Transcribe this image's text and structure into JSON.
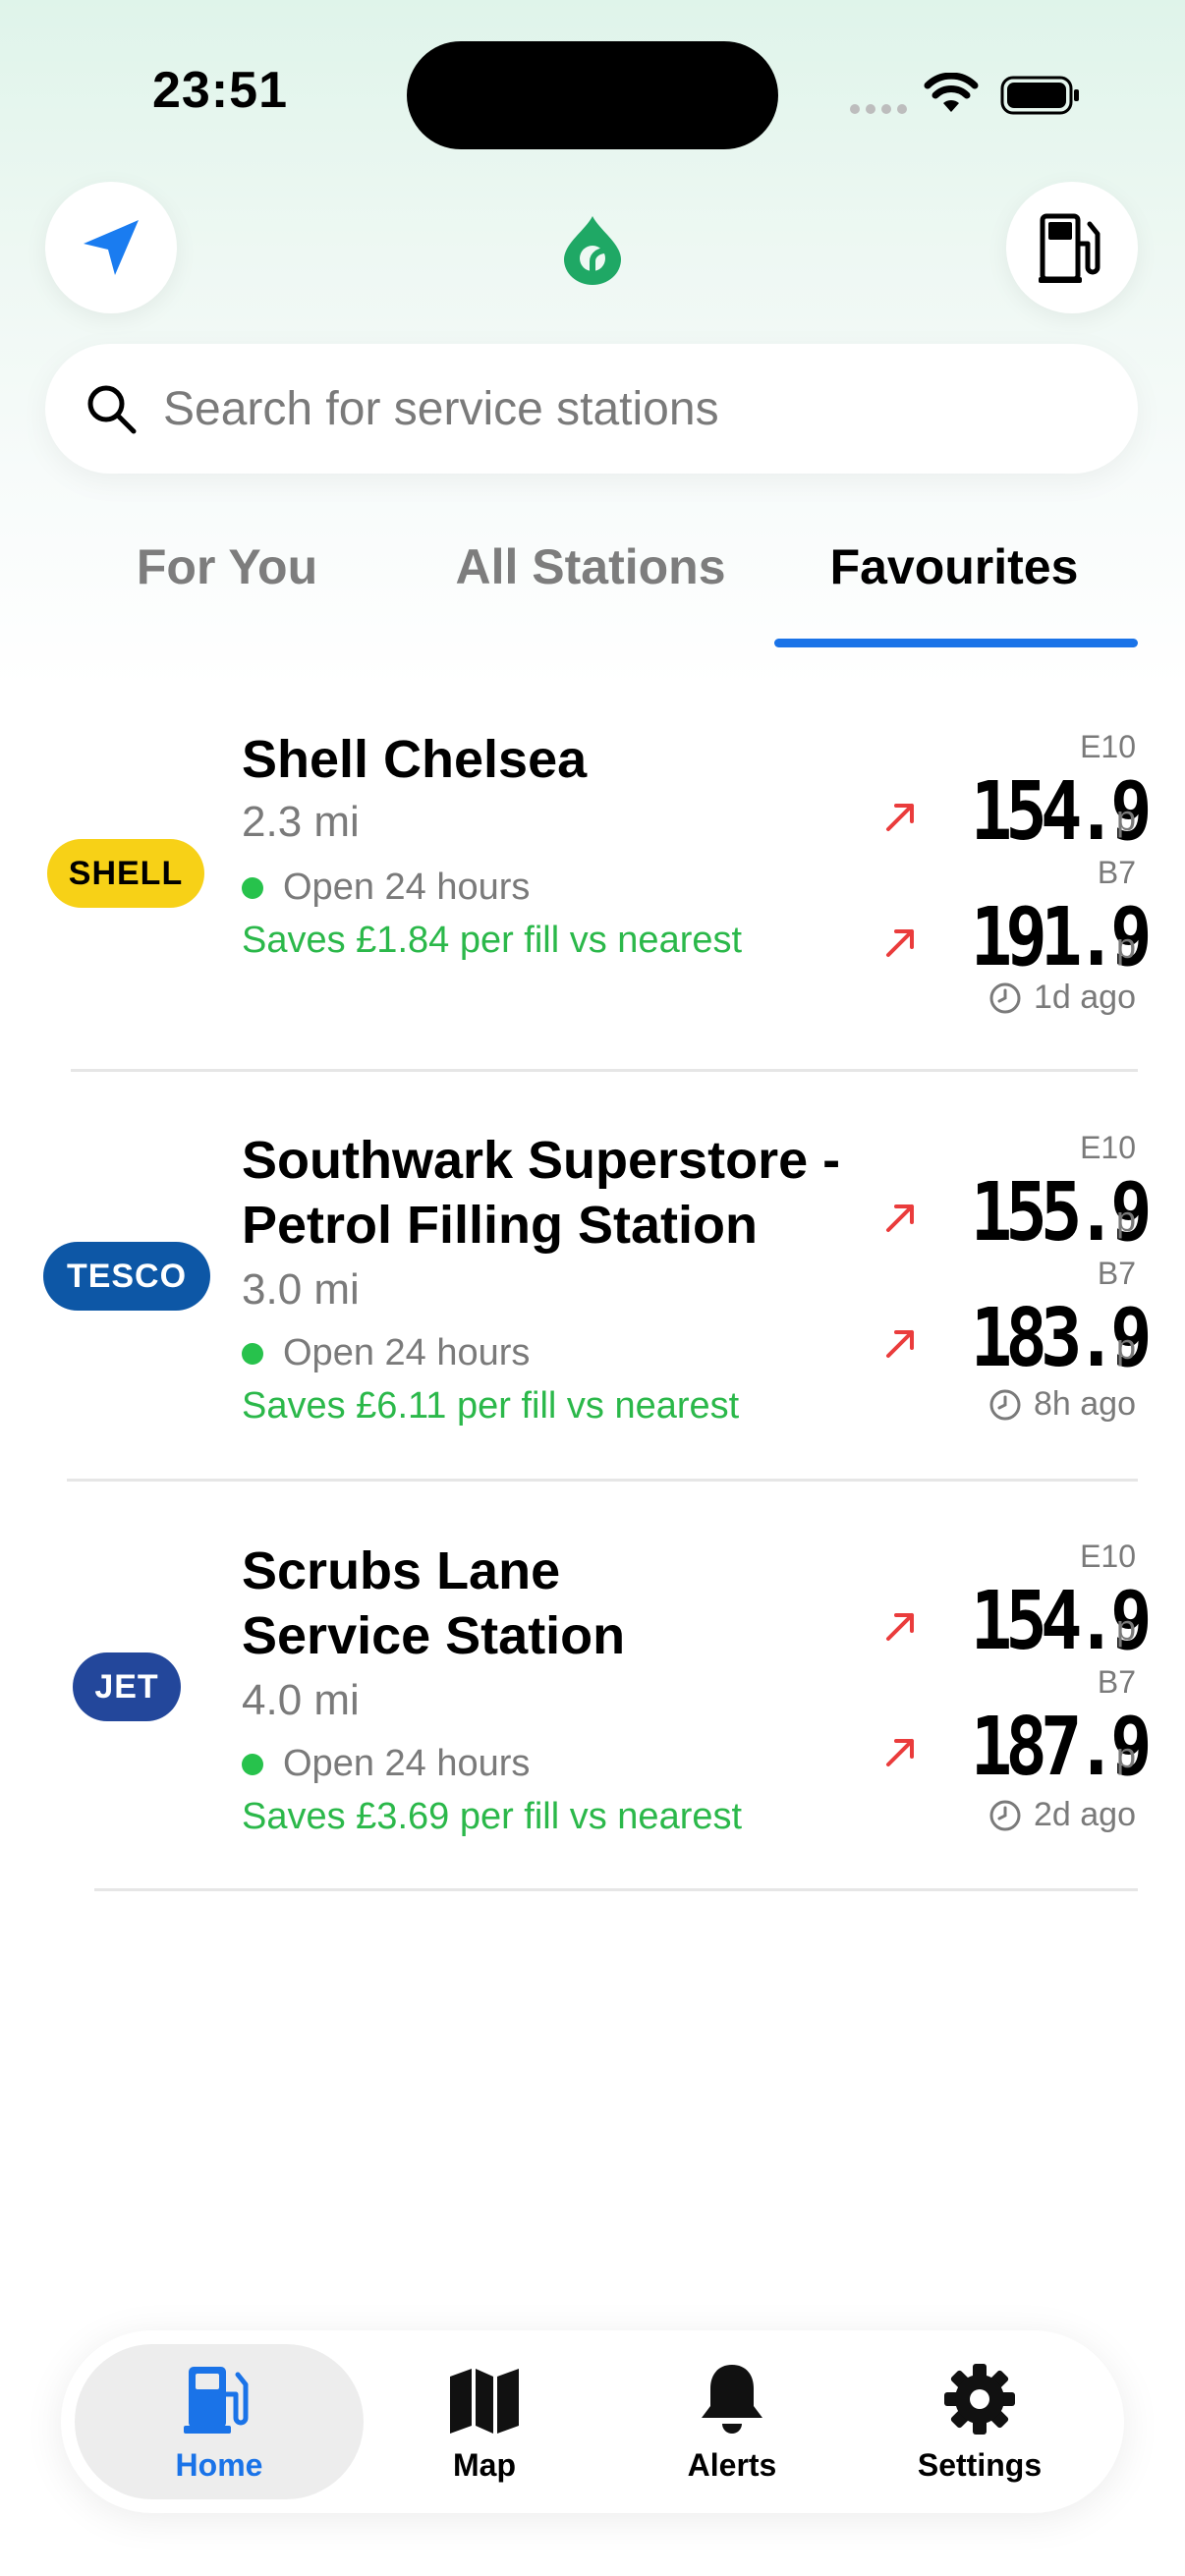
{
  "status_bar": {
    "time": "23:51"
  },
  "search": {
    "placeholder": "Search for service stations"
  },
  "tabs": [
    {
      "label": "For You",
      "active": false
    },
    {
      "label": "All Stations",
      "active": false
    },
    {
      "label": "Favourites",
      "active": true
    }
  ],
  "stations": [
    {
      "brand": "SHELL",
      "name_lines": [
        "Shell Chelsea"
      ],
      "distance": "2.3 mi",
      "status": "Open 24 hours",
      "saves": "Saves £1.84 per fill vs nearest",
      "fuels": [
        {
          "type": "E10",
          "price": "154.9",
          "unit": "p",
          "trend": "up"
        },
        {
          "type": "B7",
          "price": "191.9",
          "unit": "p",
          "trend": "up"
        }
      ],
      "updated": "1d ago"
    },
    {
      "brand": "TESCO",
      "name_lines": [
        "Southwark Superstore -",
        "Petrol Filling Station"
      ],
      "distance": "3.0 mi",
      "status": "Open 24 hours",
      "saves": "Saves £6.11 per fill vs nearest",
      "fuels": [
        {
          "type": "E10",
          "price": "155.9",
          "unit": "p",
          "trend": "up"
        },
        {
          "type": "B7",
          "price": "183.9",
          "unit": "p",
          "trend": "up"
        }
      ],
      "updated": "8h ago"
    },
    {
      "brand": "JET",
      "name_lines": [
        "Scrubs Lane",
        "Service Station"
      ],
      "distance": "4.0 mi",
      "status": "Open 24 hours",
      "saves": "Saves £3.69 per fill vs nearest",
      "fuels": [
        {
          "type": "E10",
          "price": "154.9",
          "unit": "p",
          "trend": "up"
        },
        {
          "type": "B7",
          "price": "187.9",
          "unit": "p",
          "trend": "up"
        }
      ],
      "updated": "2d ago"
    }
  ],
  "tab_bar": [
    {
      "label": "Home",
      "icon": "fuel-pump-icon",
      "active": true
    },
    {
      "label": "Map",
      "icon": "map-icon",
      "active": false
    },
    {
      "label": "Alerts",
      "icon": "bell-icon",
      "active": false
    },
    {
      "label": "Settings",
      "icon": "gear-icon",
      "active": false
    }
  ],
  "colors": {
    "accent_blue": "#1a73e8",
    "brand_green": "#1fa865",
    "saves_green": "#2bb84a",
    "trend_red": "#ea3c3c",
    "shell_yellow": "#f7d117",
    "tesco_blue": "#0d57a6",
    "jet_blue": "#23479b"
  }
}
